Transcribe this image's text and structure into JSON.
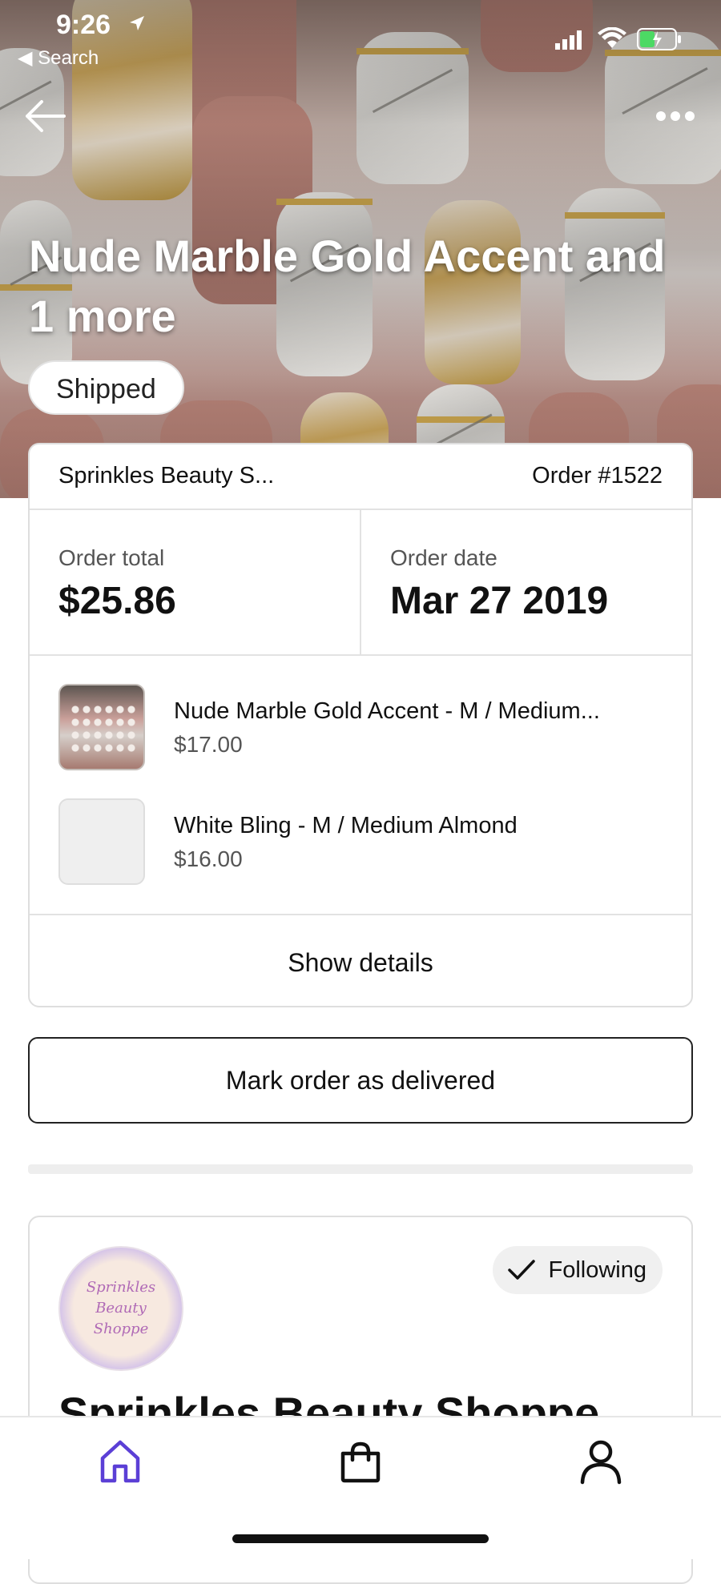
{
  "status_bar": {
    "time": "9:26",
    "back_app": "◀ Search"
  },
  "hero": {
    "title": "Nude Marble Gold Accent and 1 more",
    "status_badge": "Shipped"
  },
  "order": {
    "shop_name": "Sprinkles Beauty S...",
    "order_number": "Order #1522",
    "total_label": "Order total",
    "total_value": "$25.86",
    "date_label": "Order date",
    "date_value": "Mar 27 2019",
    "items": [
      {
        "title": "Nude Marble Gold Accent - M / Medium...",
        "price": "$17.00"
      },
      {
        "title": "White Bling - M / Medium Almond",
        "price": "$16.00"
      }
    ],
    "show_details_label": "Show details"
  },
  "actions": {
    "mark_delivered_label": "Mark order as delivered"
  },
  "shop": {
    "logo_lines": [
      "Sprinkles",
      "Beauty",
      "Shoppe"
    ],
    "follow_label": "Following",
    "name": "Sprinkles Beauty Shoppe"
  },
  "tabbar": {
    "tabs": [
      {
        "icon": "home-icon",
        "active": true
      },
      {
        "icon": "cart-icon",
        "active": false
      },
      {
        "icon": "account-icon",
        "active": false
      }
    ]
  },
  "colors": {
    "accent": "#5b3fd6",
    "text": "#111111",
    "muted": "#555555",
    "border": "#dedede"
  }
}
